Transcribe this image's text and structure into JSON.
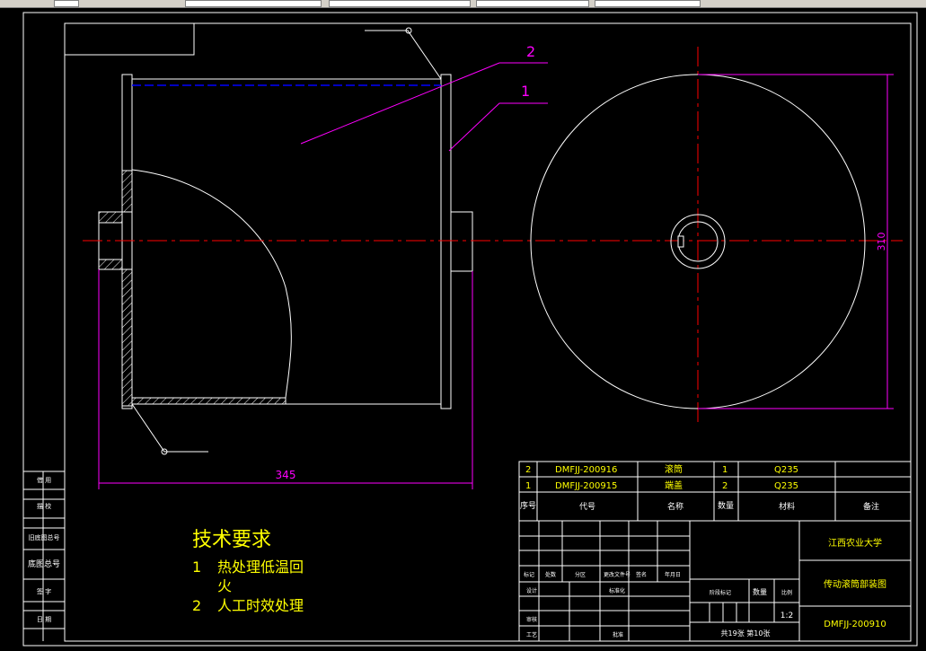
{
  "drawing": {
    "balloons": [
      "2",
      "1"
    ],
    "dims": {
      "width": "345",
      "height": "310"
    },
    "tech_req": {
      "title": "技术要求",
      "items": [
        {
          "num": "1",
          "text": "热处理低温回"
        },
        {
          "num": "",
          "text": "火"
        },
        {
          "num": "2",
          "text": "人工时效处理"
        }
      ]
    },
    "sidebar": [
      "借 用",
      "描 校",
      "旧底图总号",
      "底图总号",
      "签 字",
      "日 期"
    ]
  },
  "bom": {
    "rows": [
      {
        "seq": "2",
        "code": "DMFJJ-200916",
        "name": "滚筒",
        "qty": "1",
        "material": "Q235"
      },
      {
        "seq": "1",
        "code": "DMFJJ-200915",
        "name": "端盖",
        "qty": "2",
        "material": "Q235"
      }
    ],
    "header": {
      "seq": "序号",
      "code": "代号",
      "name": "名称",
      "qty": "数量",
      "material": "材料",
      "remark": "备注"
    }
  },
  "title_block": {
    "school": "江西农业大学",
    "drawing_name": "传动滚筒部装图",
    "drawing_no": "DMFJJ-200910",
    "scale": "1:2",
    "sheets": "共19张  第10张",
    "qty_label": "数量",
    "scale_label": "比例",
    "stage_label": "阶段标记",
    "labels": {
      "mark": "标记",
      "count": "处数",
      "zone": "分区",
      "change_no": "更改文件号",
      "sign": "签名",
      "date": "年月日",
      "design": "设计",
      "standard": "标准化",
      "review": "审核",
      "craft": "工艺",
      "approve": "批准"
    }
  },
  "colors": {
    "white": "#ffffff",
    "magenta": "#ff00ff",
    "red": "#ff0000",
    "blue": "#0000ff",
    "yellow": "#ffff00"
  }
}
